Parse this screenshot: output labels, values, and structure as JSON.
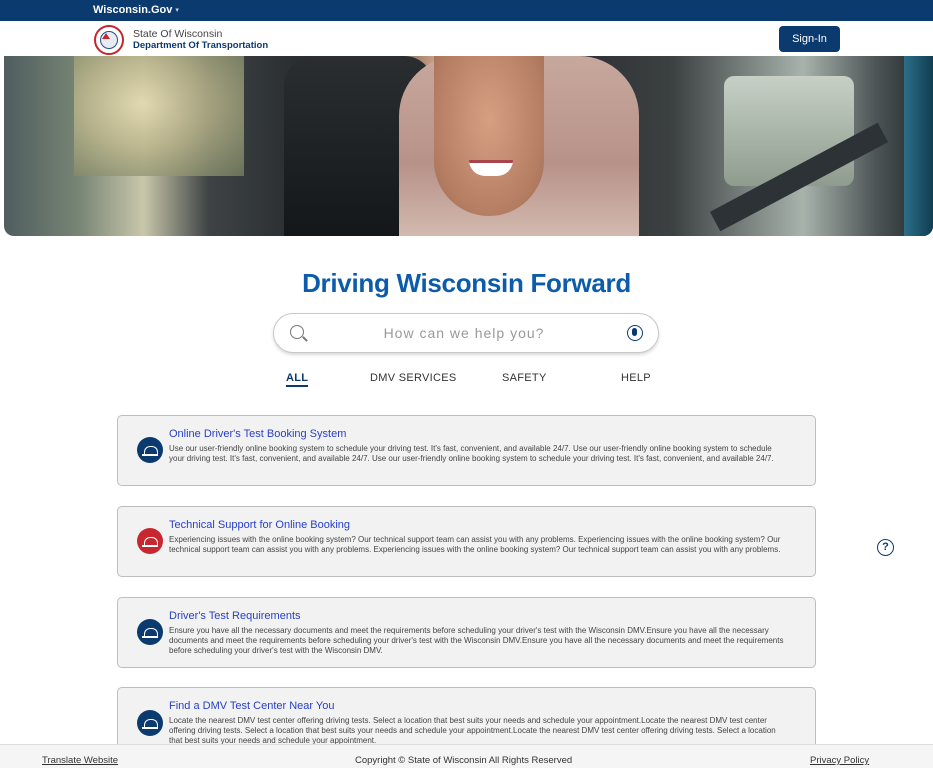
{
  "topbar": {
    "label": "Wisconsin.Gov"
  },
  "header": {
    "line1": "State Of Wisconsin",
    "line2": "Department Of Transportation",
    "signin_label": "Sign-In"
  },
  "hero": {
    "title": "Driving Wisconsin Forward"
  },
  "search": {
    "placeholder": "How can we help you?",
    "value": ""
  },
  "tabs": [
    {
      "label": "ALL",
      "active": true
    },
    {
      "label": "DMV SERVICES",
      "active": false
    },
    {
      "label": "SAFETY",
      "active": false
    },
    {
      "label": "HELP",
      "active": false
    }
  ],
  "cards": [
    {
      "title": "Online Driver's Test Booking System",
      "description": "Use our user-friendly online booking system to schedule your driving test. It's fast, convenient, and available 24/7. Use our user-friendly online booking system to schedule your driving test. It's fast, convenient, and available 24/7. Use our user-friendly online booking system to schedule your driving test. It's fast, convenient, and available 24/7.",
      "icon_color": "#0b3a6f"
    },
    {
      "title": "Technical Support for Online Booking",
      "description": "Experiencing issues with the online booking system? Our technical support team can assist you with any problems. Experiencing issues with the online booking system? Our technical support team can assist you with any problems. Experiencing issues with the online booking system? Our technical support team can assist you with any problems.",
      "icon_color": "#c7282f"
    },
    {
      "title": "Driver's Test Requirements",
      "description": "Ensure you have all the necessary documents and meet the requirements before scheduling your driver's test with the Wisconsin DMV.Ensure you have all the necessary documents and meet the requirements before scheduling your driver's test with the Wisconsin DMV.Ensure you have all the necessary documents and meet the requirements before scheduling your driver's test with the Wisconsin DMV.",
      "icon_color": "#0b3a6f"
    },
    {
      "title": "Find a DMV Test Center Near You",
      "description": "Locate the nearest DMV test center offering driving tests. Select a location that best suits your needs and schedule your appointment.Locate the nearest DMV test center offering driving tests. Select a location that best suits your needs and schedule your appointment.Locate the nearest DMV test center offering driving tests. Select a location that best suits your needs and schedule your appointment.",
      "icon_color": "#0b3a6f"
    }
  ],
  "help": {
    "glyph": "?"
  },
  "footer": {
    "translate": "Translate Website",
    "copyright": "Copyright © State of Wisconsin All Rights Reserved",
    "privacy": "Privacy Policy"
  },
  "colors": {
    "primary": "#0b3a6f",
    "title_blue": "#0d5cab",
    "link_blue": "#2840c8",
    "alert_red": "#c7282f"
  }
}
